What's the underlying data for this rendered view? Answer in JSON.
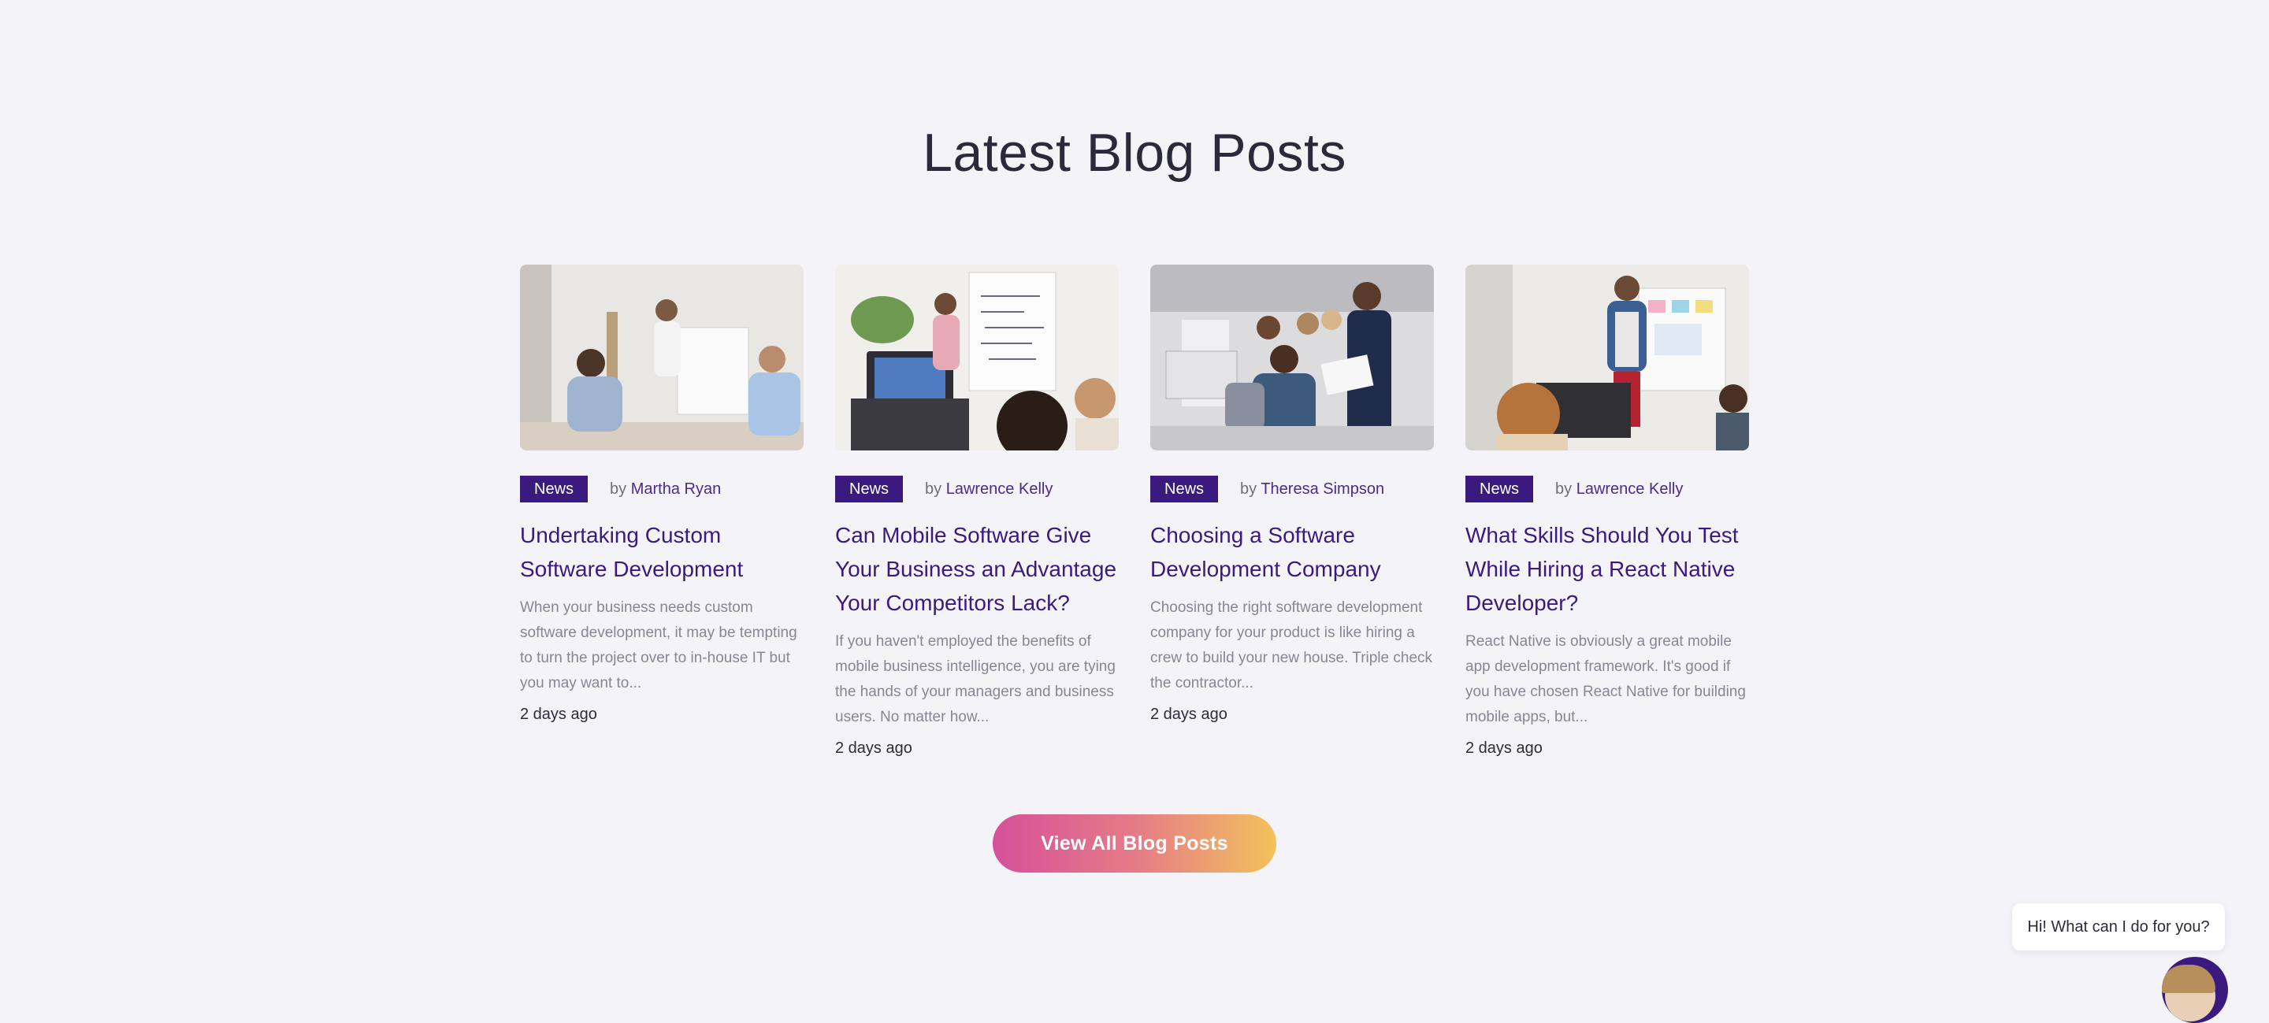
{
  "section": {
    "title": "Latest Blog Posts"
  },
  "posts": [
    {
      "tag": "News",
      "by": "by",
      "author": "Martha Ryan",
      "title": "Undertaking Custom Software Development",
      "excerpt": "When your business needs custom software development, it may be tempting to turn the project over to in-house IT but you may want to...",
      "date": "2 days ago",
      "image": "meeting-photo"
    },
    {
      "tag": "News",
      "by": "by",
      "author": "Lawrence Kelly",
      "title": "Can Mobile Software Give Your Business an Advantage Your Competitors Lack?",
      "excerpt": "If you haven't employed the benefits of mobile business intelligence, you are tying the hands of your managers and business users. No matter how...",
      "date": "2 days ago",
      "image": "presentation-photo"
    },
    {
      "tag": "News",
      "by": "by",
      "author": "Theresa Simpson",
      "title": "Choosing a Software Development Company",
      "excerpt": "Choosing the right software development company for your product is like hiring a crew to build your new house. Triple check the contractor...",
      "date": "2 days ago",
      "image": "team-photo"
    },
    {
      "tag": "News",
      "by": "by",
      "author": "Lawrence Kelly",
      "title": "What Skills Should You Test While Hiring a React Native Developer?",
      "excerpt": "React Native is obviously a great mobile app development framework. It's good if you have chosen React Native for building mobile apps, but...",
      "date": "2 days ago",
      "image": "whiteboard-photo"
    }
  ],
  "cta": {
    "label": "View All Blog Posts"
  },
  "chat": {
    "greeting": "Hi! What can I do for you?"
  },
  "colors": {
    "background": "#f4f4f8",
    "accent": "#3b1a80",
    "cta_gradient_start": "#d5509a",
    "cta_gradient_end": "#f2c25c"
  }
}
